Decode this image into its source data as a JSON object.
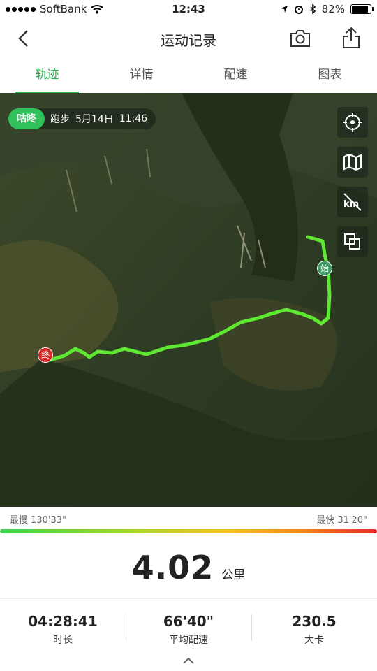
{
  "status_bar": {
    "carrier": "SoftBank",
    "time": "12:43",
    "battery": "82%"
  },
  "nav": {
    "title": "运动记录"
  },
  "tabs": [
    {
      "label": "轨迹",
      "active": true
    },
    {
      "label": "详情",
      "active": false
    },
    {
      "label": "配速",
      "active": false
    },
    {
      "label": "图表",
      "active": false
    }
  ],
  "map": {
    "badge": "咕咚",
    "activity": "跑步",
    "date": "5月14日",
    "time": "11:46",
    "start_label": "始",
    "end_label": "终",
    "route_color": "#5ee832"
  },
  "pace_legend": {
    "slowest": "最慢 130'33\"",
    "fastest": "最快 31'20\""
  },
  "summary": {
    "distance": "4.02",
    "unit": "公里"
  },
  "stats": [
    {
      "value": "04:28:41",
      "label": "时长"
    },
    {
      "value": "66'40\"",
      "label": "平均配速"
    },
    {
      "value": "230.5",
      "label": "大卡"
    }
  ]
}
